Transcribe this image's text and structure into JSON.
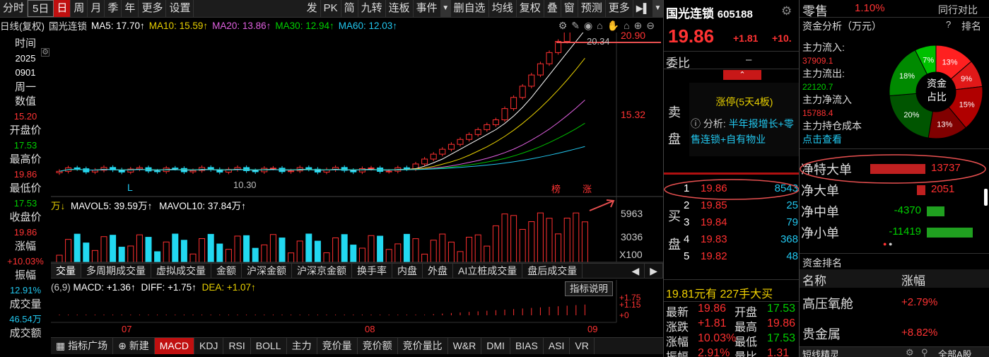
{
  "toolbar": {
    "items": [
      "分时",
      "5日",
      "日",
      "周",
      "月",
      "季",
      "年",
      "更多",
      "设置"
    ],
    "right_items": [
      "发",
      "PK",
      "简",
      "九转",
      "连板",
      "事件",
      "删自选",
      "均线",
      "复权",
      "叠",
      "窗",
      "预测",
      "更多"
    ]
  },
  "ma_bar": {
    "prefix": "日线(复权)",
    "stock": "国光连锁",
    "ma5": "MA5: 17.70↑",
    "ma10": "MA10: 15.59↑",
    "ma20": "MA20: 13.86↑",
    "ma30": "MA30: 12.94↑",
    "ma60": "MA60: 12.03↑"
  },
  "left_panel": {
    "rows": [
      {
        "label": "时间",
        "value": "2025"
      },
      {
        "label": "",
        "value": "0901"
      },
      {
        "label": "周一",
        "value": ""
      },
      {
        "label": "数值",
        "value": "15.20"
      },
      {
        "label": "开盘价",
        "value": "17.53"
      },
      {
        "label": "最高价",
        "value": "19.86"
      },
      {
        "label": "最低价",
        "value": "17.53"
      },
      {
        "label": "收盘价",
        "value": "19.86"
      },
      {
        "label": "涨幅",
        "value": "+10.03%"
      },
      {
        "label": "振幅",
        "value": "12.91%"
      },
      {
        "label": "成交量",
        "value": "46.54万"
      },
      {
        "label": "成交额",
        "value": ""
      }
    ]
  },
  "price_chart": {
    "y_labels": [
      "20.90",
      "15.32"
    ],
    "high_label": "20.34",
    "low_label": "10.30",
    "marks": [
      "L",
      "榜",
      "涨"
    ]
  },
  "volume_chart": {
    "title": "万↓",
    "mavol5": "MAVOL5: 39.59万↑",
    "mavol10": "MAVOL10: 37.84万↑",
    "y_labels": [
      "5963",
      "3036",
      "X100"
    ]
  },
  "indicator_tabs": [
    "交量",
    "多周期成交量",
    "虚拟成交量",
    "金额",
    "沪深金额",
    "沪深京金额",
    "换手率",
    "内盘",
    "外盘",
    "AI立桩成交量",
    "盘后成交量"
  ],
  "macd": {
    "params": "(6,9)",
    "macd": "MACD: +1.36↑",
    "diff": "DIFF: +1.75↑",
    "dea": "DEA: +1.07↑",
    "button": "指标说明",
    "y_labels": [
      "+1.75",
      "+1.15",
      "+0"
    ],
    "x_labels": [
      "07",
      "08",
      "09"
    ]
  },
  "bottom_tabs": [
    "指标广场",
    "新建",
    "MACD",
    "KDJ",
    "RSI",
    "BOLL",
    "主力",
    "竞价量",
    "竞价额",
    "竞价量比",
    "W&R",
    "DMI",
    "BIAS",
    "ASI",
    "VR"
  ],
  "quote": {
    "name": "国光连锁",
    "code": "605188",
    "price": "19.86",
    "change": "+1.81",
    "pct": "+10.",
    "weibi_label": "委比",
    "weibi_value": "–",
    "limit_text": "涨停(5天4板)",
    "analysis_label": "分析:",
    "analysis_text": "半年报增长+零售连锁+自有物业",
    "sell_label": [
      "卖",
      "盘"
    ],
    "buy_label": [
      "买",
      "盘"
    ],
    "bids": [
      {
        "n": "1",
        "p": "19.86",
        "v": "8543"
      },
      {
        "n": "2",
        "p": "19.85",
        "v": "25"
      },
      {
        "n": "3",
        "p": "19.84",
        "v": "79"
      },
      {
        "n": "4",
        "p": "19.83",
        "v": "368"
      },
      {
        "n": "5",
        "p": "19.82",
        "v": "48"
      }
    ],
    "big_buy_text": "19.81元有 227手大买",
    "stats": [
      {
        "l": "最新",
        "v": "19.86",
        "l2": "开盘",
        "v2": "17.53"
      },
      {
        "l": "涨跌",
        "v": "+1.81",
        "l2": "最高",
        "v2": "19.86"
      },
      {
        "l": "涨幅",
        "v": "10.03%",
        "l2": "最低",
        "v2": "17.53"
      },
      {
        "l": "振幅",
        "v": "2.91%",
        "l2": "量比",
        "v2": "1.31"
      }
    ]
  },
  "right": {
    "sector": "零售",
    "sector_pct": "1.10%",
    "compare": "同行对比",
    "fund_title": "资金分析（万元）",
    "fund_help": "?",
    "fund_rank": "排名",
    "flows": [
      {
        "label": "主力流入:",
        "value": "37909.1"
      },
      {
        "label": "主力流出:",
        "value": "22120.7"
      },
      {
        "label": "主力净流入",
        "value": "15788.4"
      },
      {
        "label": "主力持仓成本",
        "value": "点击查看"
      }
    ],
    "pie_center": [
      "资金",
      "占比"
    ],
    "pie_slices": [
      {
        "label": "13%",
        "value": 13,
        "color": "#ff2020"
      },
      {
        "label": "9%",
        "value": 9,
        "color": "#e01818"
      },
      {
        "label": "15%",
        "value": 15,
        "color": "#b00000"
      },
      {
        "label": "13%",
        "value": 13,
        "color": "#800000"
      },
      {
        "label": "20%",
        "value": 20,
        "color": "#005500"
      },
      {
        "label": "18%",
        "value": 18,
        "color": "#008a00"
      },
      {
        "label": "7%",
        "value": 7,
        "color": "#00c000"
      }
    ],
    "net": [
      {
        "label": "净特大单",
        "value": "13737",
        "bar": 1.0,
        "dir": "pos"
      },
      {
        "label": "净大单",
        "value": "2051",
        "bar": 0.15,
        "dir": "pos"
      },
      {
        "label": "净中单",
        "value": "-4370",
        "bar": 0.32,
        "dir": "neg"
      },
      {
        "label": "净小单",
        "value": "-11419",
        "bar": 0.83,
        "dir": "neg"
      }
    ],
    "rank_title": "资金排名",
    "rank_headers": [
      "名称",
      "涨幅"
    ],
    "ranks": [
      {
        "name": "高压氧舱",
        "pct": "+2.79%"
      },
      {
        "name": "贵金属",
        "pct": "+8.82%"
      }
    ],
    "bottom_label": "短线精灵",
    "bottom_select": "全部A股"
  }
}
